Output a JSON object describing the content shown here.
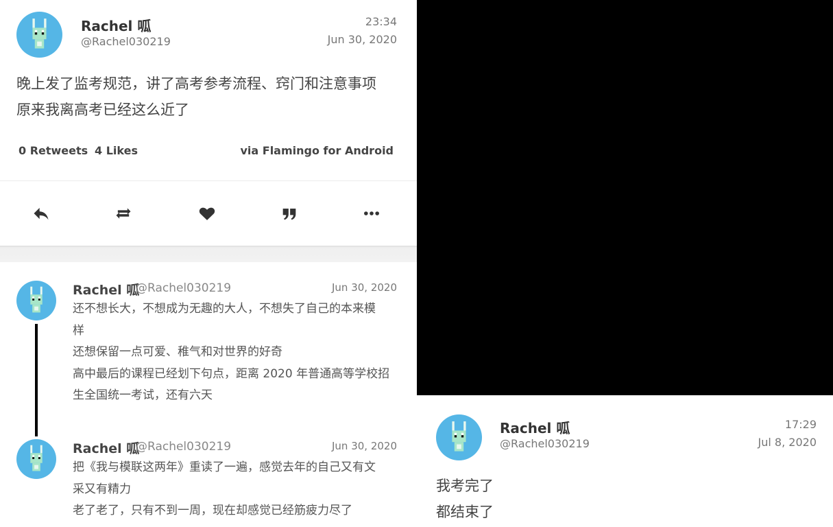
{
  "main_tweet": {
    "name": "Rachel 呱",
    "handle": "@Rachel030219",
    "time": "23:34",
    "date": "Jun 30, 2020",
    "lines": [
      "晚上发了监考规范，讲了高考参考流程、窍门和注意事项",
      "原来我离高考已经这么近了"
    ],
    "retweets": "0 Retweets",
    "likes": "4 Likes",
    "via": "via Flamingo for Android"
  },
  "actions": [
    {
      "icon": "reply-icon"
    },
    {
      "icon": "retweet-icon"
    },
    {
      "icon": "heart-icon"
    },
    {
      "icon": "quote-icon"
    },
    {
      "icon": "more-icon"
    }
  ],
  "replies": [
    {
      "name": "Rachel 呱",
      "handle": "@Rachel030219",
      "date": "Jun 30, 2020",
      "lines": [
        "还不想长大，不想成为无趣的大人，不想失了自己的本来模",
        "样",
        "还想保留一点可爱、稚气和对世界的好奇",
        "高中最后的课程已经划下句点，距离 2020 年普通高等学校招",
        "生全国统一考试，还有六天"
      ]
    },
    {
      "name": "Rachel 呱",
      "handle": "@Rachel030219",
      "date": "Jun 30, 2020",
      "lines": [
        "把《我与模联这两年》重读了一遍，感觉去年的自己又有文",
        "采又有精力",
        "老了老了，只有不到一周，现在却感觉已经筋疲力尽了"
      ]
    }
  ],
  "right_tweet": {
    "name": "Rachel 呱",
    "handle": "@Rachel030219",
    "time": "17:29",
    "date": "Jul 8, 2020",
    "lines": [
      "我考完了",
      "都结束了"
    ]
  },
  "colors": {
    "avatar_bg": "#55b6e6",
    "avatar_figure": "#a8e6c8",
    "accent_text": "#333333"
  }
}
